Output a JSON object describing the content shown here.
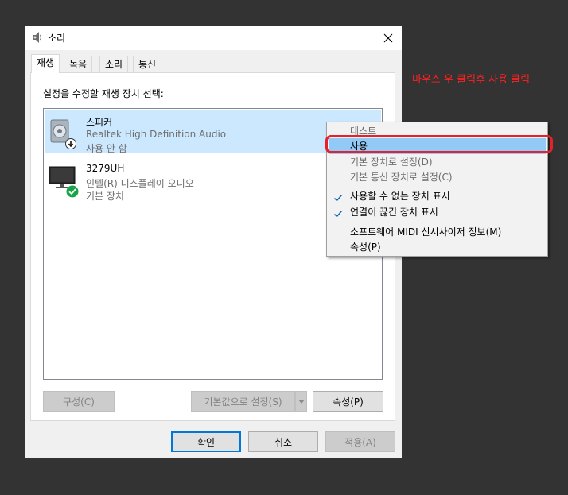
{
  "window": {
    "title": "소리"
  },
  "tabs": [
    {
      "label": "재생"
    },
    {
      "label": "녹음"
    },
    {
      "label": "소리"
    },
    {
      "label": "통신"
    }
  ],
  "panel": {
    "instruction": "설정을 수정할 재생 장치 선택:"
  },
  "devices": [
    {
      "name": "스피커",
      "description": "Realtek High Definition Audio",
      "status": "사용 안 함",
      "icon": "speaker-icon",
      "badge": "disabled-arrow-badge"
    },
    {
      "name": "3279UH",
      "description": "인텔(R) 디스플레이 오디오",
      "status": "기본 장치",
      "icon": "monitor-icon",
      "badge": "default-check-badge"
    }
  ],
  "panel_buttons": {
    "configure": "구성(C)",
    "set_default": "기본값으로 설정(S)",
    "properties": "속성(P)"
  },
  "dialog_buttons": {
    "ok": "확인",
    "cancel": "취소",
    "apply": "적용(A)"
  },
  "context_menu": {
    "items": [
      {
        "label": "테스트",
        "enabled": false
      },
      {
        "label": "사용",
        "enabled": true,
        "highlighted": true
      },
      {
        "label": "기본 장치로 설정(D)",
        "enabled": false
      },
      {
        "label": "기본 통신 장치로 설정(C)",
        "enabled": false
      },
      {
        "label": "사용할 수 없는 장치 표시",
        "enabled": true,
        "checked": true
      },
      {
        "label": "연결이 끊긴 장치 표시",
        "enabled": true,
        "checked": true
      },
      {
        "label": "소프트웨어 MIDI 신시사이저 정보(M)",
        "enabled": true
      },
      {
        "label": "속성(P)",
        "enabled": true
      }
    ]
  },
  "annotation": {
    "text": "마우스 우 클릭후 사용 클릭",
    "color": "#ff2020"
  }
}
